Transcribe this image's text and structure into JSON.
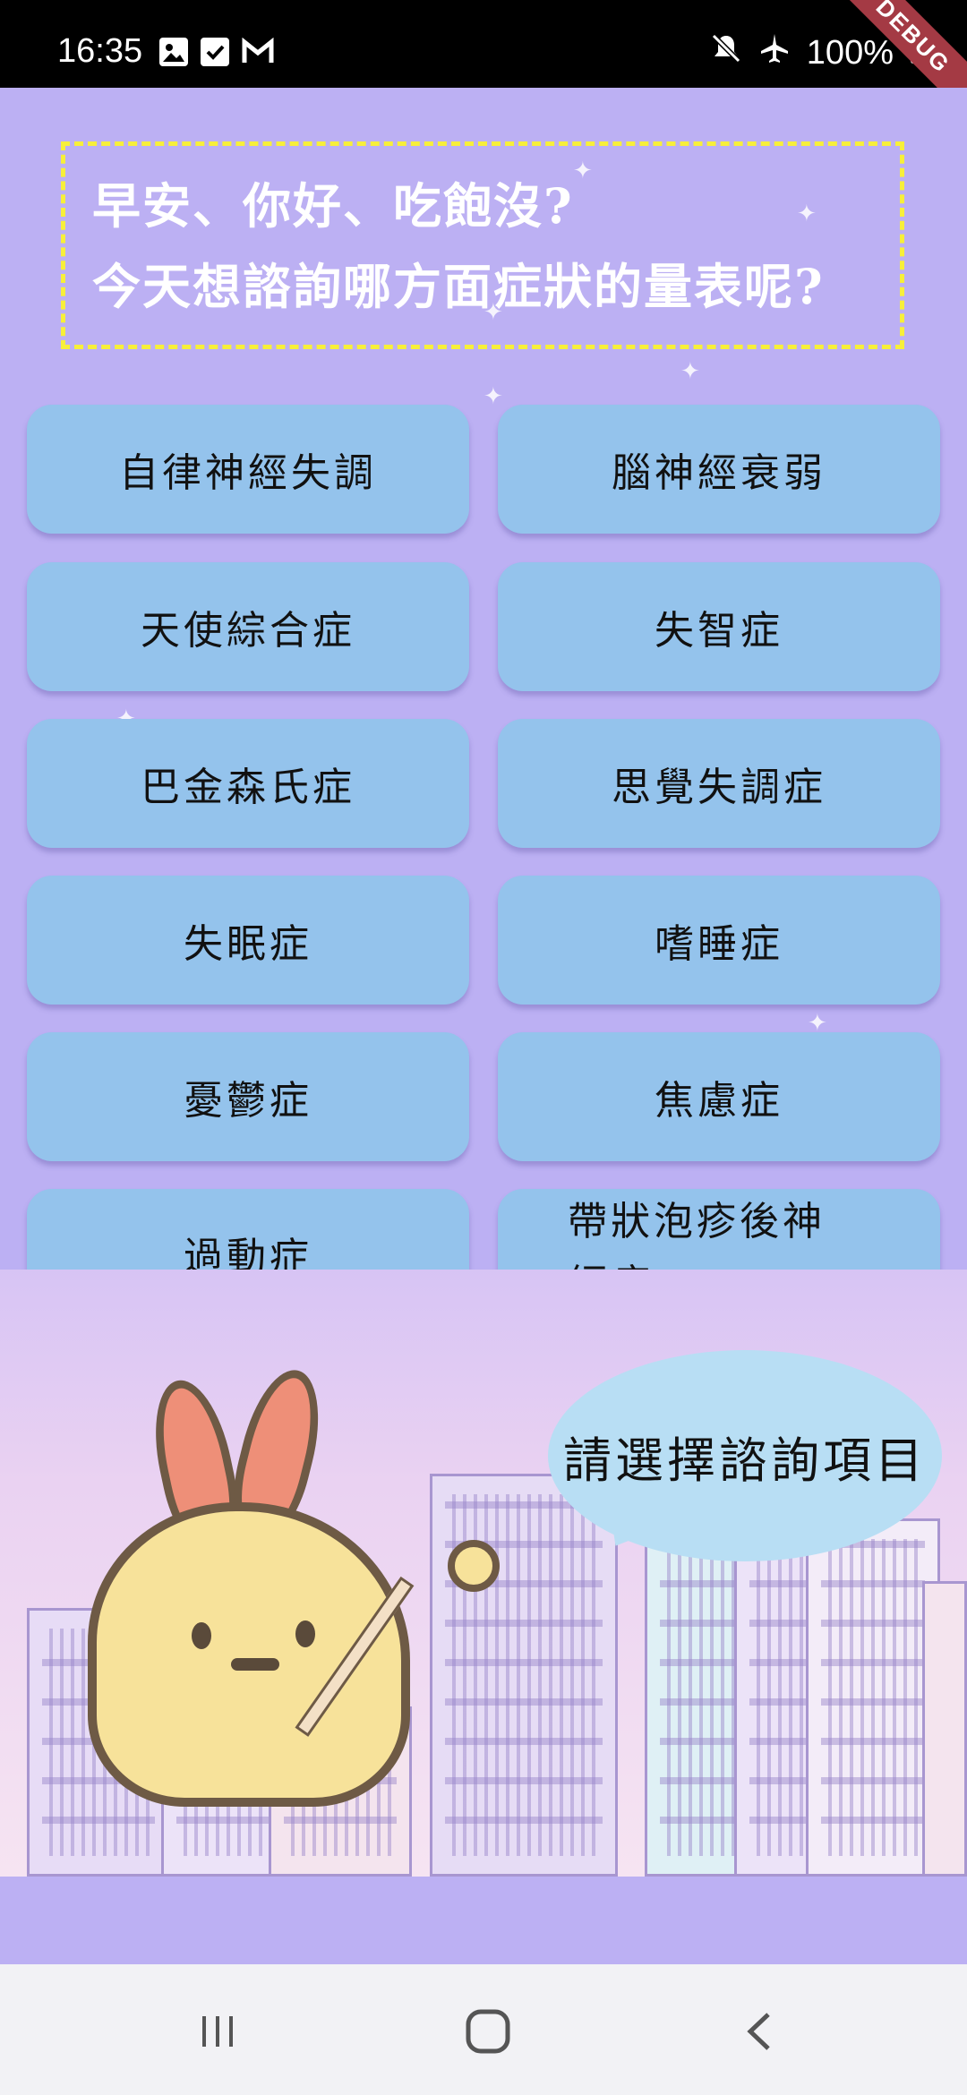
{
  "status_bar": {
    "time": "16:35",
    "battery": "100%",
    "icons_left": [
      "gallery-icon",
      "checkbox-icon",
      "gmail-icon"
    ],
    "icons_right": [
      "mute-icon",
      "airplane-icon",
      "battery-icon"
    ]
  },
  "debug_banner": "DEBUG",
  "greeting": {
    "line1": "早安、你好、吃飽沒?",
    "line2": "今天想諮詢哪方面症狀的量表呢?"
  },
  "buttons": [
    {
      "label": "自律神經失調"
    },
    {
      "label": "腦神經衰弱"
    },
    {
      "label": "天使綜合症"
    },
    {
      "label": "失智症"
    },
    {
      "label": "巴金森氏症"
    },
    {
      "label": "思覺失調症"
    },
    {
      "label": "失眠症"
    },
    {
      "label": "嗜睡症"
    },
    {
      "label": "憂鬱症"
    },
    {
      "label": "焦慮症"
    },
    {
      "label": "過動症"
    },
    {
      "label": "帶狀泡疹後神經痛",
      "line1": "帶狀泡疹後神",
      "line2": "經痛"
    }
  ],
  "speech_bubble": "請選擇諮詢項目",
  "nav": [
    "recent-apps-icon",
    "home-icon",
    "back-icon"
  ],
  "colors": {
    "background": "#bcb0f3",
    "button": "#94c3ec",
    "border_dashed": "#f7ef3a",
    "bubble": "#b8def4"
  }
}
